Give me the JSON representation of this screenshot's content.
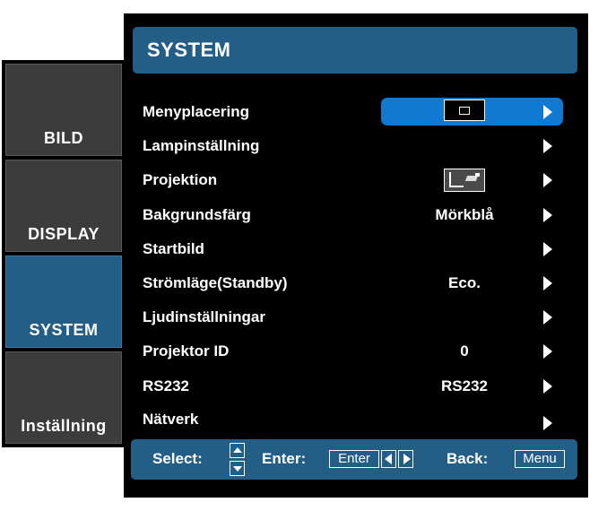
{
  "tabs": [
    {
      "label": "BILD",
      "active": false
    },
    {
      "label": "DISPLAY",
      "active": false
    },
    {
      "label": "SYSTEM",
      "active": true
    },
    {
      "label": "Inställning",
      "active": false
    }
  ],
  "header": {
    "title": "SYSTEM"
  },
  "menu": [
    {
      "label": "Menyplacering",
      "value": "",
      "value_icon": "menu-position-icon",
      "selected": true
    },
    {
      "label": "Lampinställning",
      "value": ""
    },
    {
      "label": "Projektion",
      "value": "",
      "value_icon": "projection-front-desktop-icon"
    },
    {
      "label": "Bakgrundsfärg",
      "value": "Mörkblå"
    },
    {
      "label": "Startbild",
      "value": ""
    },
    {
      "label": "Strömläge(Standby)",
      "value": "Eco."
    },
    {
      "label": "Ljudinställningar",
      "value": ""
    },
    {
      "label": "Projektor ID",
      "value": "0"
    },
    {
      "label": "RS232",
      "value": "RS232"
    },
    {
      "label": "Nätverk",
      "value": ""
    }
  ],
  "footer": {
    "select_label": "Select:",
    "enter_label": "Enter:",
    "enter_key": "Enter",
    "back_label": "Back:",
    "menu_key": "Menu"
  },
  "colors": {
    "accent": "#235e86",
    "highlight": "#1079d2",
    "tab_inactive": "#3c3c3c",
    "background": "#000000"
  }
}
